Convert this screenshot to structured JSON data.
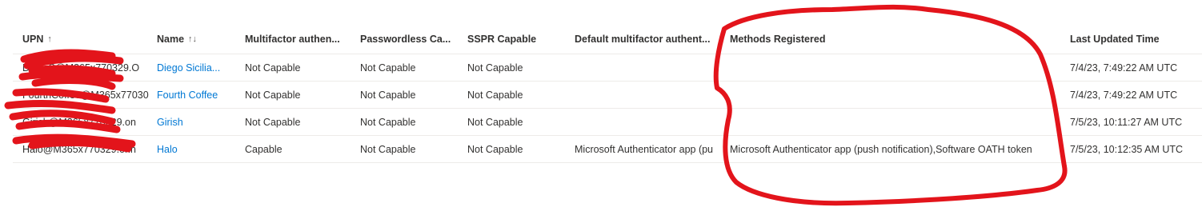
{
  "columns": {
    "upn": "UPN",
    "upn_sort": "↑",
    "name": "Name",
    "name_sort": "↑↓",
    "mfa": "Multifactor authen...",
    "passwordless": "Passwordless Ca...",
    "sspr": "SSPR Capable",
    "default_mfa": "Default multifactor authent...",
    "methods": "Methods Registered",
    "updated": "Last Updated Time"
  },
  "rows": [
    {
      "upn": "DiegoS@M365x770329.O",
      "name": "Diego Sicilia...",
      "mfa": "Not Capable",
      "passwordless": "Not Capable",
      "sspr": "Not Capable",
      "default_mfa": "",
      "methods": "",
      "updated": "7/4/23, 7:49:22 AM UTC"
    },
    {
      "upn": "FourthCoffee@M365x77030",
      "name": "Fourth Coffee",
      "mfa": "Not Capable",
      "passwordless": "Not Capable",
      "sspr": "Not Capable",
      "default_mfa": "",
      "methods": "",
      "updated": "7/4/23, 7:49:22 AM UTC"
    },
    {
      "upn": "Girish@M365x770329.on",
      "name": "Girish",
      "mfa": "Not Capable",
      "passwordless": "Not Capable",
      "sspr": "Not Capable",
      "default_mfa": "",
      "methods": "",
      "updated": "7/5/23, 10:11:27 AM UTC"
    },
    {
      "upn": "Halo@M365x770329.onn",
      "name": "Halo",
      "mfa": "Capable",
      "passwordless": "Not Capable",
      "sspr": "Not Capable",
      "default_mfa": "Microsoft Authenticator app (pu",
      "methods": "Microsoft Authenticator app (push notification),Software OATH token",
      "updated": "7/5/23, 10:12:35 AM UTC"
    }
  ],
  "annotation": {
    "redaction_color": "#e3141b",
    "highlight_color": "#e3141b"
  }
}
